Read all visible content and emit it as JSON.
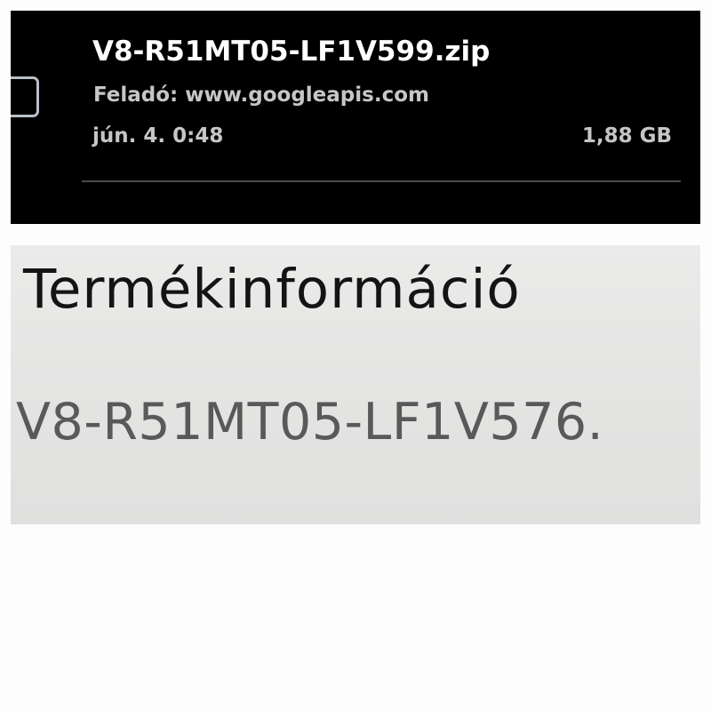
{
  "download_item": {
    "file_name": "V8-R51MT05-LF1V599.zip",
    "source": "Feladó: www.googleapis.com",
    "date": "jún. 4. 0:48",
    "size": "1,88 GB"
  },
  "product_info": {
    "heading": "Termékinformáció",
    "code": "V8-R51MT05-LF1V576."
  },
  "colors": {
    "download_background": "#000000",
    "download_title": "#ffffff",
    "download_meta": "#c6c6c6",
    "product_background": "#e6e6e5",
    "product_heading": "#141414",
    "product_code": "#595959"
  },
  "icons": {
    "checkbox": "checkbox-icon"
  }
}
